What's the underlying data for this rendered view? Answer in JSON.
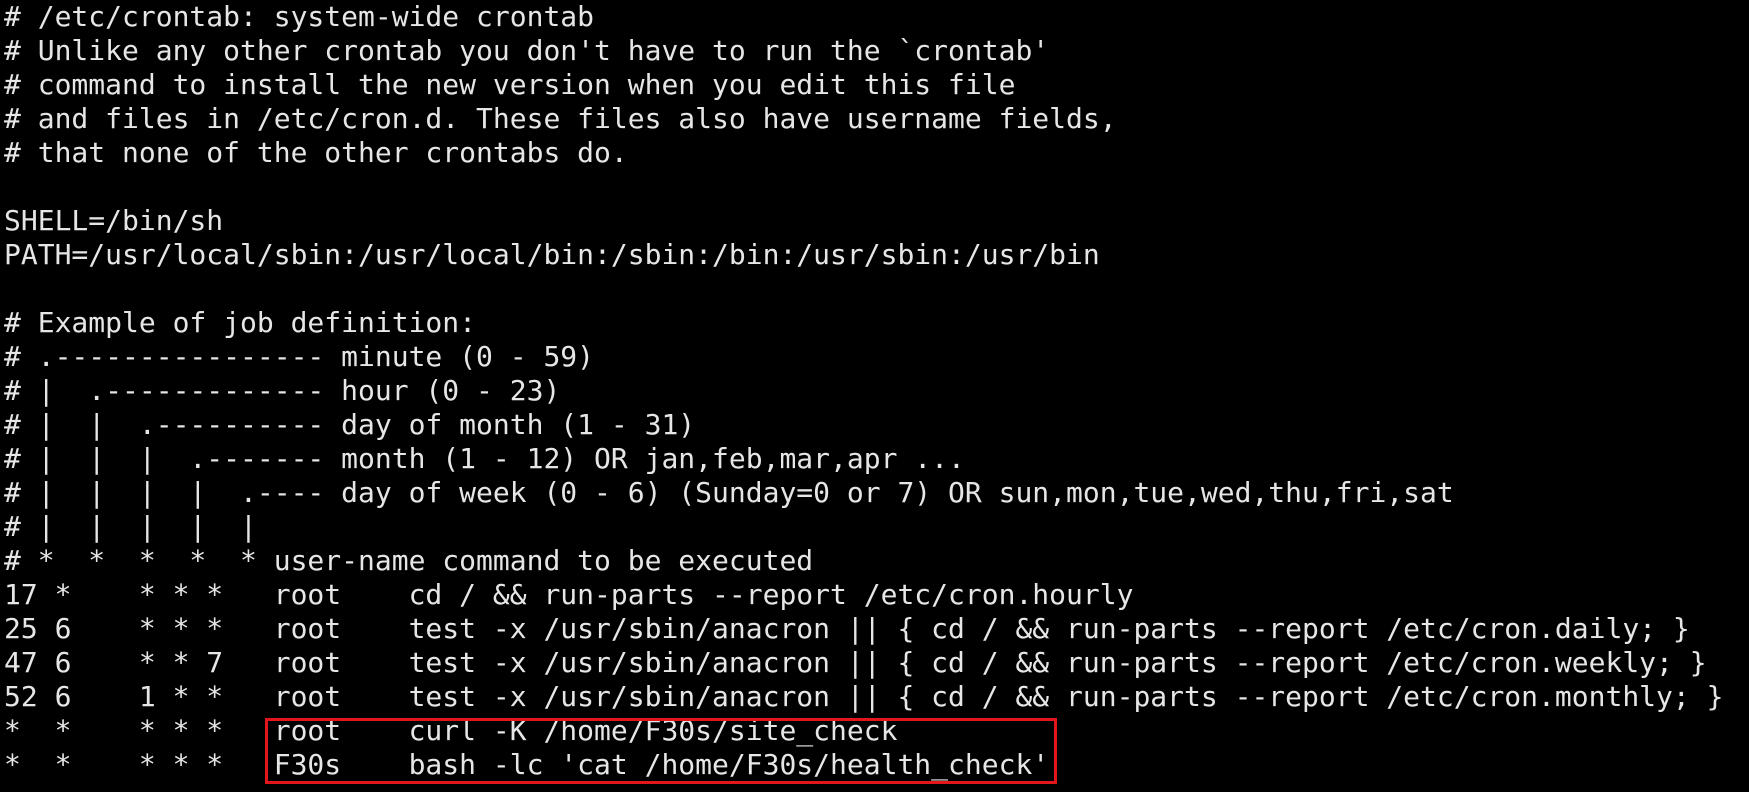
{
  "terminal": {
    "lines": [
      "# /etc/crontab: system-wide crontab",
      "# Unlike any other crontab you don't have to run the `crontab'",
      "# command to install the new version when you edit this file",
      "# and files in /etc/cron.d. These files also have username fields,",
      "# that none of the other crontabs do.",
      "",
      "SHELL=/bin/sh",
      "PATH=/usr/local/sbin:/usr/local/bin:/sbin:/bin:/usr/sbin:/usr/bin",
      "",
      "# Example of job definition:",
      "# .---------------- minute (0 - 59)",
      "# |  .------------- hour (0 - 23)",
      "# |  |  .---------- day of month (1 - 31)",
      "# |  |  |  .------- month (1 - 12) OR jan,feb,mar,apr ...",
      "# |  |  |  |  .---- day of week (0 - 6) (Sunday=0 or 7) OR sun,mon,tue,wed,thu,fri,sat",
      "# |  |  |  |  |",
      "# *  *  *  *  * user-name command to be executed",
      "17 *    * * *   root    cd / && run-parts --report /etc/cron.hourly",
      "25 6    * * *   root    test -x /usr/sbin/anacron || { cd / && run-parts --report /etc/cron.daily; }",
      "47 6    * * 7   root    test -x /usr/sbin/anacron || { cd / && run-parts --report /etc/cron.weekly; }",
      "52 6    1 * *   root    test -x /usr/sbin/anacron || { cd / && run-parts --report /etc/cron.monthly; }",
      "*  *    * * *   root    curl -K /home/F30s/site_check",
      "*  *    * * *   F30s    bash -lc 'cat /home/F30s/health_check'"
    ]
  },
  "colors": {
    "background": "#000000",
    "text": "#e6e6e6",
    "highlight": "#e2161b"
  }
}
